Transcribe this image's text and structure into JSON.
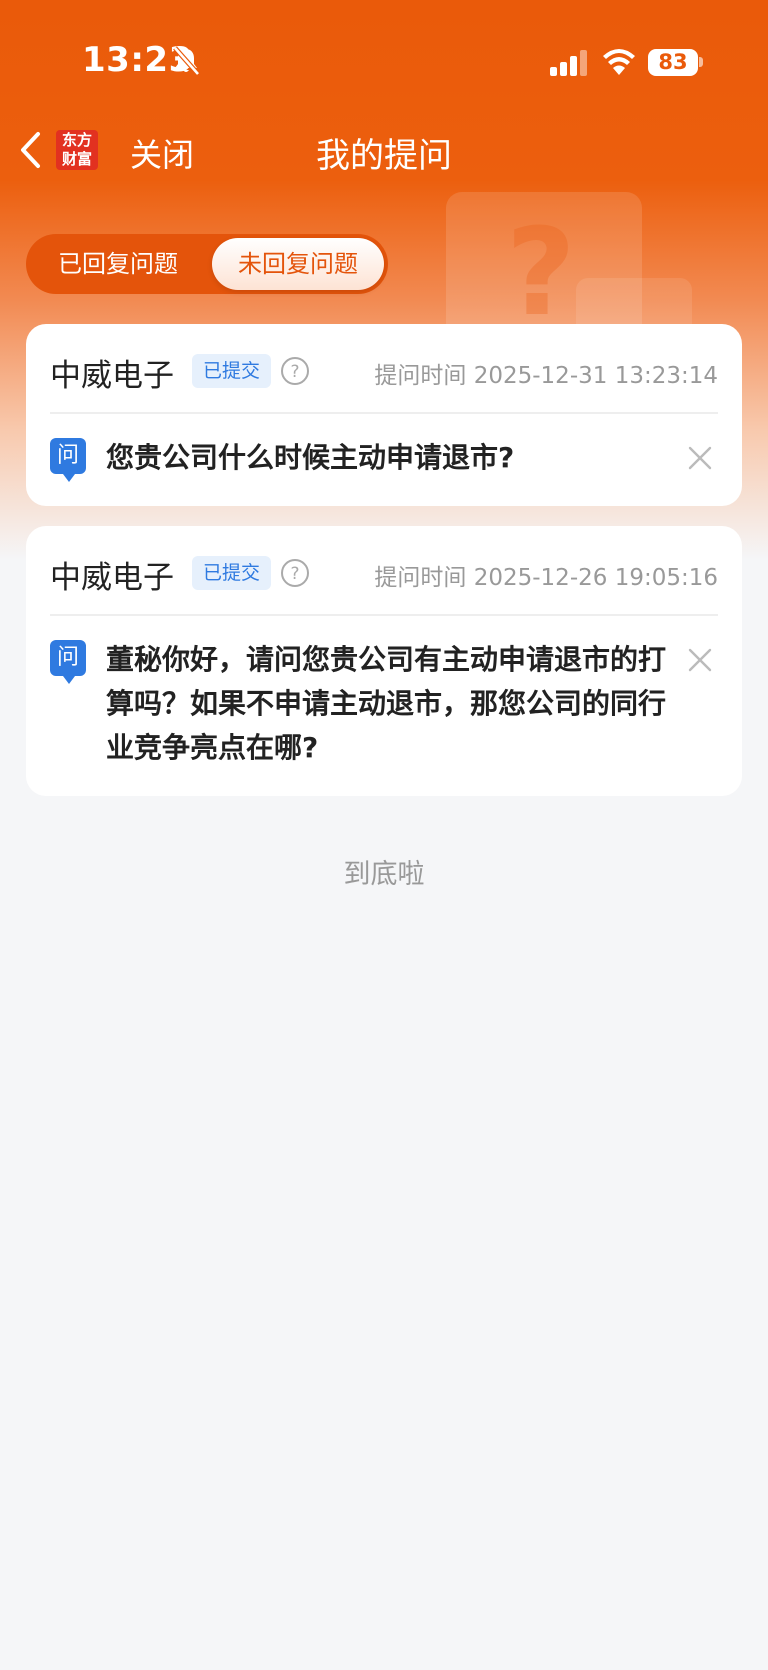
{
  "status_bar": {
    "time": "13:23",
    "battery": "83"
  },
  "nav": {
    "logo_line1": "东方",
    "logo_line2": "财富",
    "close_label": "关闭",
    "title": "我的提问"
  },
  "decor": {
    "question_mark": "?"
  },
  "tabs": [
    {
      "label": "已回复问题",
      "active": false
    },
    {
      "label": "未回复问题",
      "active": true
    }
  ],
  "questions": [
    {
      "company": "中威电子",
      "status": "已提交",
      "time": "提问时间 2025-12-31 13:23:14",
      "icon_label": "问",
      "text": "您贵公司什么时候主动申请退市?"
    },
    {
      "company": "中威电子",
      "status": "已提交",
      "time": "提问时间 2025-12-26 19:05:16",
      "icon_label": "问",
      "text": "董秘你好，请问您贵公司有主动申请退市的打算吗？如果不申请主动退市，那您公司的同行业竞争亮点在哪?"
    }
  ],
  "footer": {
    "end_text": "到底啦"
  },
  "colors": {
    "brand": "#ea5a0a",
    "accent_blue": "#2f7ae0",
    "background": "#f5f6f8"
  }
}
